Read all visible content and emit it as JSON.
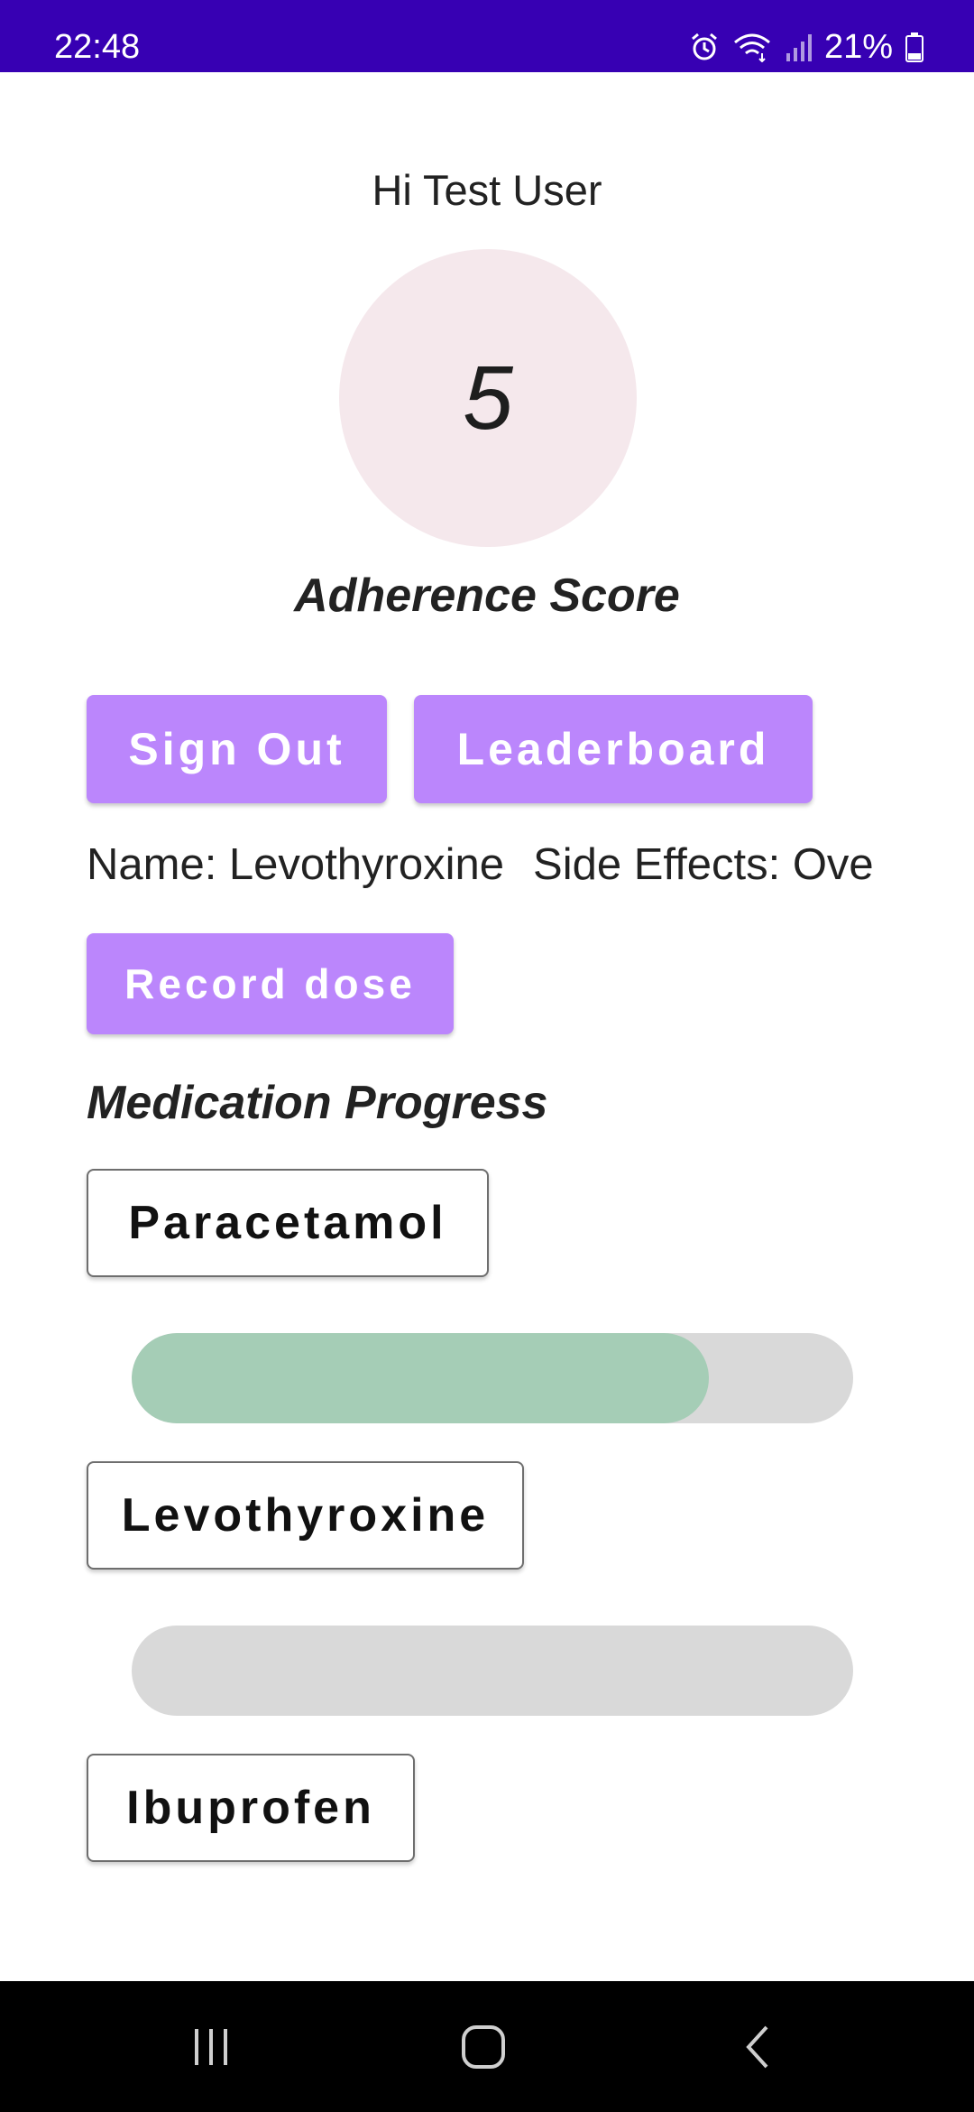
{
  "status_bar": {
    "time": "22:48",
    "battery": "21%",
    "icons": [
      "alarm-icon",
      "wifi-icon",
      "signal-icon",
      "battery-icon"
    ]
  },
  "header": {
    "greeting": "Hi Test User"
  },
  "score": {
    "value": "5",
    "label": "Adherence Score"
  },
  "buttons": {
    "sign_out": "Sign Out",
    "leaderboard": "Leaderboard",
    "record_dose": "Record dose"
  },
  "medication": {
    "name": "Name: Levothyroxine",
    "side_effects": "Side Effects: Ove"
  },
  "progress": {
    "heading": "Medication Progress",
    "items": [
      {
        "name": "Paracetamol",
        "progress": 0.8
      },
      {
        "name": "Levothyroxine",
        "progress": 0.0
      },
      {
        "name": "Ibuprofen"
      }
    ]
  },
  "nav": {
    "icons": [
      "recent-apps-icon",
      "home-icon",
      "back-icon"
    ]
  },
  "colors": {
    "status_bar": "#3700b3",
    "primary_button": "#bb86fc",
    "score_circle": "#f5e8ec",
    "progress_fill": "#a5cdb6",
    "progress_track": "#d9d9d9"
  }
}
